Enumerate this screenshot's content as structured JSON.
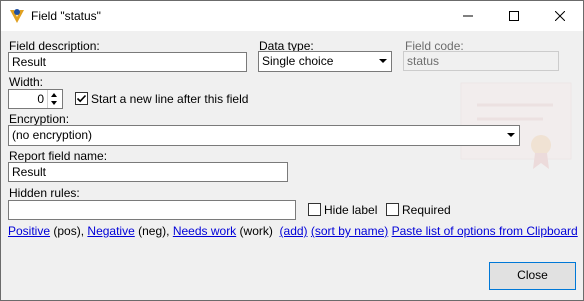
{
  "window": {
    "title": "Field \"status\"",
    "controls": [
      "minimize-icon",
      "maximize-icon",
      "close-icon"
    ]
  },
  "form": {
    "field_description": {
      "label": "Field description:",
      "value": "Result"
    },
    "data_type": {
      "label": "Data type:",
      "value": "Single choice"
    },
    "field_code": {
      "label": "Field code:",
      "value": "status"
    },
    "width": {
      "label": "Width:",
      "value": "0"
    },
    "new_line_checkbox": {
      "label": "Start a new line after this field",
      "checked": true
    },
    "encryption": {
      "label": "Encryption:",
      "value": "(no encryption)"
    },
    "report_field_name": {
      "label": "Report field name:",
      "value": "Result"
    },
    "hidden_rules": {
      "label": "Hidden rules:",
      "value": ""
    },
    "hide_label": {
      "label": "Hide label",
      "checked": false
    },
    "required": {
      "label": "Required",
      "checked": false
    }
  },
  "options": {
    "items": [
      {
        "name": "Positive",
        "code": "(pos)"
      },
      {
        "name": "Negative",
        "code": "(neg)"
      },
      {
        "name": "Needs work",
        "code": "(work)"
      }
    ],
    "separators": [
      ",",
      ","
    ],
    "add_link": "(add)",
    "sort_link": "(sort by name)",
    "paste_link": "Paste list of options from Clipboard"
  },
  "buttons": {
    "close": "Close"
  },
  "colors": {
    "link": "#0000d8",
    "background": "#f0f0f0",
    "titlebar": "#ffffff"
  }
}
